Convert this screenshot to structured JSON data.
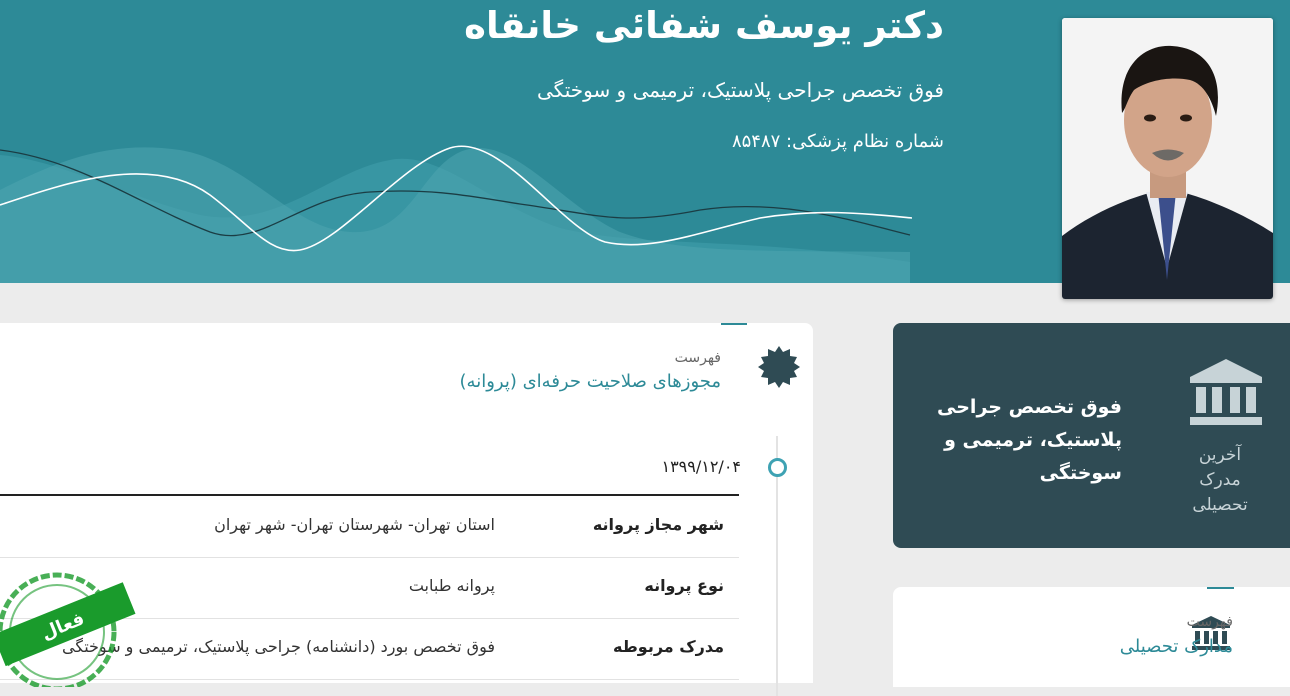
{
  "doctor": {
    "name": "دکتر یوسف شفائی خانقاه",
    "specialty": "فوق تخصص جراحی پلاستیک، ترمیمی و سوختگی",
    "registration": "شماره نظام پزشکی: ۸۵۴۸۷"
  },
  "latest_degree": {
    "label": "آخرین مدرک تحصیلی",
    "value": "فوق تخصص جراحی پلاستیک، ترمیمی و سوختگی",
    "icon": "institution-icon"
  },
  "education_card": {
    "caption": "فهرست",
    "title": "مدارک تحصیلی",
    "icon": "institution-icon"
  },
  "licenses_card": {
    "caption": "فهرست",
    "title": "مجوزهای صلاحیت حرفه‌ای (پروانه)",
    "icon": "badge-icon",
    "entries": [
      {
        "date": "۱۳۹۹/۱۲/۰۴",
        "status": "فعال",
        "rows": [
          {
            "label": "شهر مجاز پروانه",
            "value": "استان تهران- شهرستان تهران- شهر تهران"
          },
          {
            "label": "نوع پروانه",
            "value": "پروانه طبابت"
          },
          {
            "label": "مدرک مربوطه",
            "value": "فوق تخصص بورد (دانشنامه) جراحی پلاستیک، ترمیمی و سوختگی"
          }
        ]
      }
    ]
  },
  "colors": {
    "header_teal": "#2d8a97",
    "dark_card": "#2f4b54",
    "stamp_green": "#1a9b2c"
  }
}
